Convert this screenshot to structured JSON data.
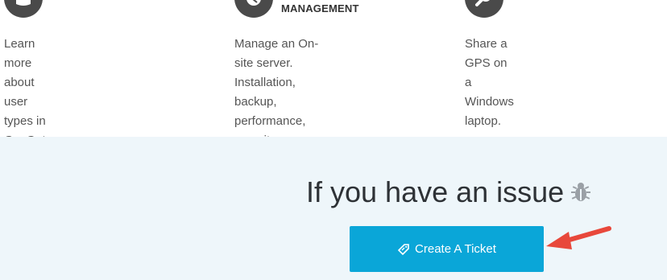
{
  "cards": [
    {
      "icon": "user-icon",
      "title": "",
      "text": "Learn more about user types in\nGpsGate."
    },
    {
      "icon": "server-icon",
      "title": "MANAGEMENT",
      "text": "Manage an On-site server.\nInstallation, backup,\nperformance, security,\ntroubleshooting, etc."
    },
    {
      "icon": "gps-icon",
      "title": "",
      "text": "Share a GPS on a Windows\nlaptop."
    }
  ],
  "issue": {
    "title": "If you have an issue",
    "icon": "bug-icon",
    "button_label": "Create A Ticket",
    "button_icon": "ticket-icon",
    "button_color": "#0aa6d8",
    "background_color": "#eef6fa",
    "annotation_arrow_color": "#e8483b"
  }
}
